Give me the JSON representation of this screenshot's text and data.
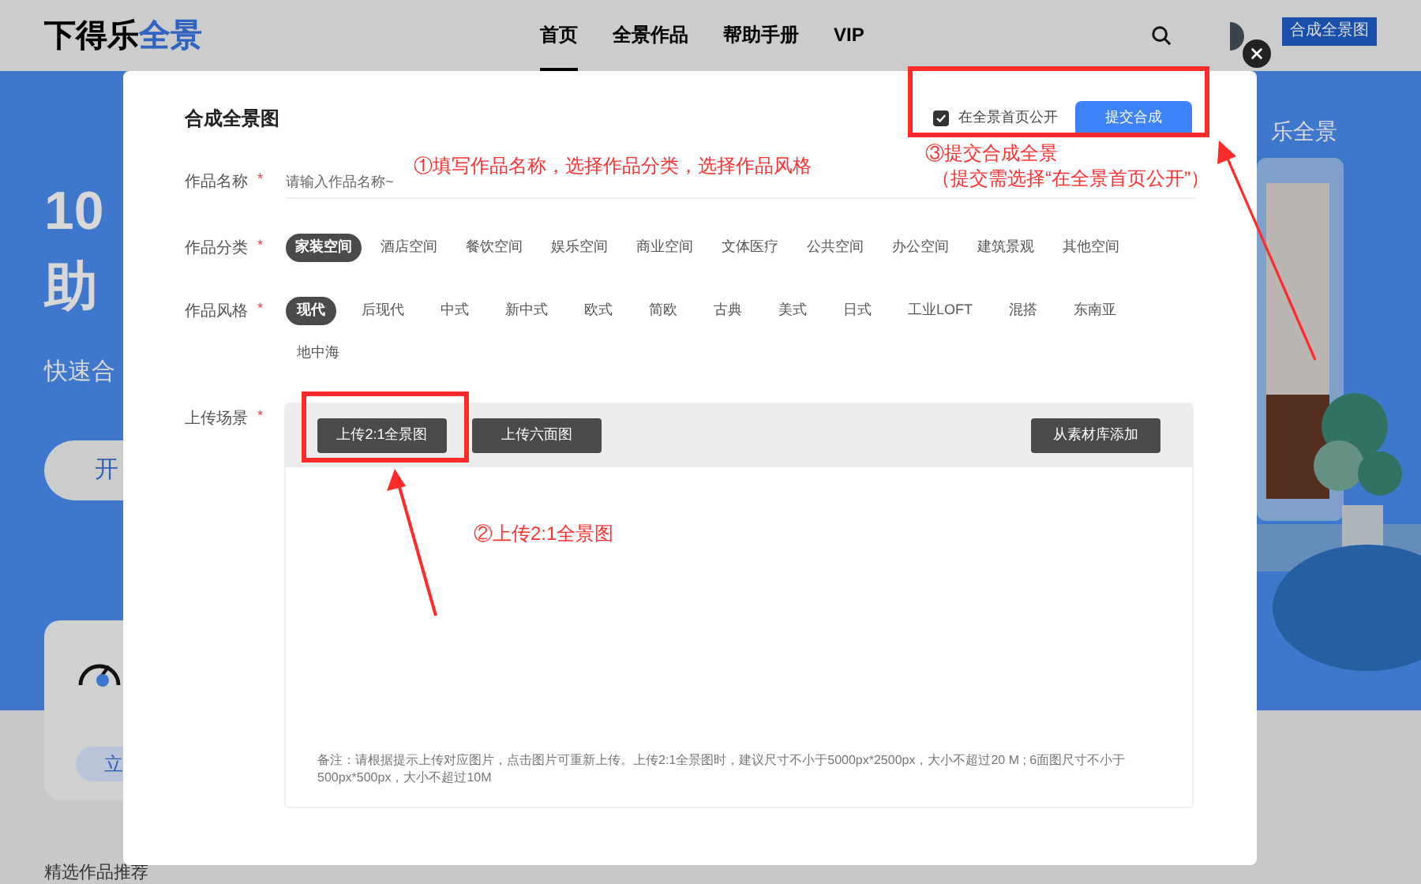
{
  "header": {
    "logo": "下得乐",
    "logo_accent": "全景",
    "nav": [
      {
        "label": "首页",
        "selected": true
      },
      {
        "label": "全景作品",
        "selected": false
      },
      {
        "label": "帮助手册",
        "selected": false
      },
      {
        "label": "VIP",
        "selected": false
      }
    ],
    "create_button": "合成全景图"
  },
  "background": {
    "hero_title": "10",
    "hero_title_2": "助",
    "hero_subtitle": "快速合",
    "hero_button": "开",
    "right_caption": "乐全景",
    "card_button": "立",
    "section_title": "精选作品推荐"
  },
  "dialog": {
    "title": "合成全景图",
    "public_option": {
      "label": "在全景首页公开",
      "checked": true
    },
    "submit_button": "提交合成",
    "name_field": {
      "label": "作品名称",
      "required_mark": "*",
      "placeholder": "请输入作品名称~"
    },
    "category": {
      "label": "作品分类",
      "required_mark": "*",
      "options": [
        {
          "label": "家装空间",
          "selected": true
        },
        {
          "label": "酒店空间",
          "selected": false
        },
        {
          "label": "餐饮空间",
          "selected": false
        },
        {
          "label": "娱乐空间",
          "selected": false
        },
        {
          "label": "商业空间",
          "selected": false
        },
        {
          "label": "文体医疗",
          "selected": false
        },
        {
          "label": "公共空间",
          "selected": false
        },
        {
          "label": "办公空间",
          "selected": false
        },
        {
          "label": "建筑景观",
          "selected": false
        },
        {
          "label": "其他空间",
          "selected": false
        }
      ]
    },
    "style": {
      "label": "作品风格",
      "required_mark": "*",
      "options": [
        {
          "label": "现代",
          "selected": true
        },
        {
          "label": "后现代",
          "selected": false
        },
        {
          "label": "中式",
          "selected": false
        },
        {
          "label": "新中式",
          "selected": false
        },
        {
          "label": "欧式",
          "selected": false
        },
        {
          "label": "简欧",
          "selected": false
        },
        {
          "label": "古典",
          "selected": false
        },
        {
          "label": "美式",
          "selected": false
        },
        {
          "label": "日式",
          "selected": false
        },
        {
          "label": "工业LOFT",
          "selected": false
        },
        {
          "label": "混搭",
          "selected": false
        },
        {
          "label": "东南亚",
          "selected": false
        },
        {
          "label": "地中海",
          "selected": false
        }
      ]
    },
    "upload": {
      "label": "上传场景",
      "required_mark": "*",
      "buttons": [
        "上传2:1全景图",
        "上传六面图"
      ],
      "library_button": "从素材库添加",
      "note": "备注：请根据提示上传对应图片，点击图片可重新上传。上传2:1全景图时，建议尺寸不小于5000px*2500px，大小不超过20 M ; 6面图尺寸不小于500px*500px，大小不超过10M"
    }
  },
  "annotations": {
    "step_1": "①填写作品名称，选择作品分类，选择作品风格",
    "step_2": "②上传2:1全景图",
    "step_3": "③提交合成全景",
    "step_3_note": "（提交需选择“在全景首页公开”）"
  }
}
